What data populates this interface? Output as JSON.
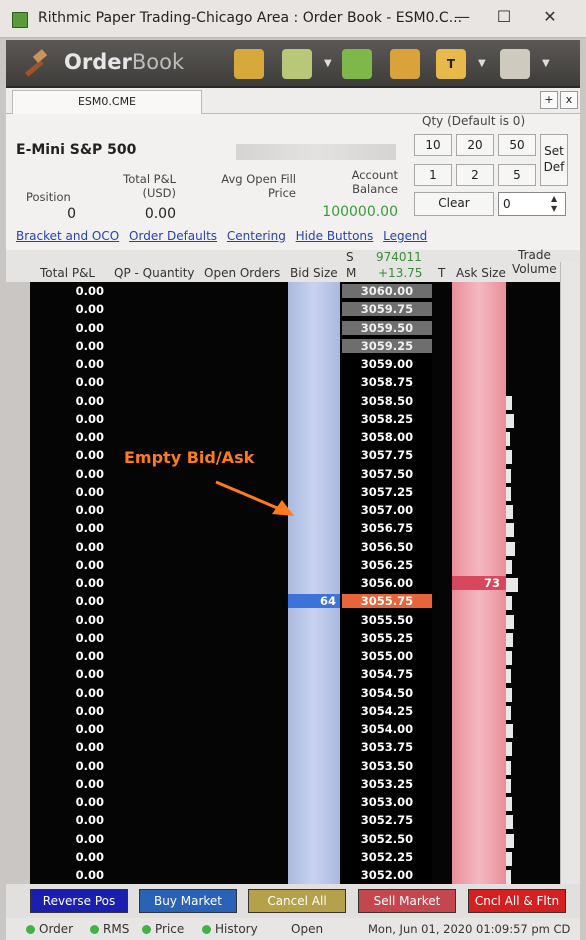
{
  "window": {
    "title": "Rithmic Paper Trading-Chicago Area : Order Book - ESM0.C..."
  },
  "toolbar": {
    "logo_bold": "Order",
    "logo_light": "Book"
  },
  "tab": {
    "label": "ESM0.CME",
    "add": "+",
    "close": "x"
  },
  "instrument": {
    "name": "E-Mini S&P 500"
  },
  "stats": {
    "position_label": "Position",
    "position": "0",
    "pnl_label": "Total P&L (USD)",
    "pnl": "0.00",
    "avg_label": "Avg Open Fill Price",
    "balance_label": "Account Balance",
    "balance": "100000.00"
  },
  "qty": {
    "title": "Qty (Default is 0)",
    "buttons": [
      "10",
      "20",
      "50",
      "1",
      "2",
      "5"
    ],
    "set_def": "Set Def",
    "clear": "Clear",
    "value": "0"
  },
  "links": [
    "Bracket and OCO",
    "Order Defaults",
    "Centering",
    "Hide Buttons",
    "Legend"
  ],
  "columns": {
    "total_pl": "Total P&L",
    "qp": "QP - Quantity",
    "open_orders": "Open Orders",
    "bid_size": "Bid Size",
    "s": "S",
    "m": "M",
    "volume": "974011",
    "change": "+13.75",
    "t": "T",
    "ask_size": "Ask Size",
    "trade": "Trade",
    "trade_volume": "Volume"
  },
  "ladder": [
    {
      "pl": "0.00",
      "price": "3060.00",
      "style": "gray"
    },
    {
      "pl": "0.00",
      "price": "3059.75",
      "style": "gray"
    },
    {
      "pl": "0.00",
      "price": "3059.50",
      "style": "gray"
    },
    {
      "pl": "0.00",
      "price": "3059.25",
      "style": "gray"
    },
    {
      "pl": "0.00",
      "price": "3059.00"
    },
    {
      "pl": "0.00",
      "price": "3058.75"
    },
    {
      "pl": "0.00",
      "price": "3058.50"
    },
    {
      "pl": "0.00",
      "price": "3058.25"
    },
    {
      "pl": "0.00",
      "price": "3058.00"
    },
    {
      "pl": "0.00",
      "price": "3057.75"
    },
    {
      "pl": "0.00",
      "price": "3057.50"
    },
    {
      "pl": "0.00",
      "price": "3057.25"
    },
    {
      "pl": "0.00",
      "price": "3057.00"
    },
    {
      "pl": "0.00",
      "price": "3056.75"
    },
    {
      "pl": "0.00",
      "price": "3056.50"
    },
    {
      "pl": "0.00",
      "price": "3056.25"
    },
    {
      "pl": "0.00",
      "price": "3056.00",
      "ask": "73"
    },
    {
      "pl": "0.00",
      "price": "3055.75",
      "style": "last",
      "bid": "64"
    },
    {
      "pl": "0.00",
      "price": "3055.50"
    },
    {
      "pl": "0.00",
      "price": "3055.25"
    },
    {
      "pl": "0.00",
      "price": "3055.00"
    },
    {
      "pl": "0.00",
      "price": "3054.75"
    },
    {
      "pl": "0.00",
      "price": "3054.50"
    },
    {
      "pl": "0.00",
      "price": "3054.25"
    },
    {
      "pl": "0.00",
      "price": "3054.00"
    },
    {
      "pl": "0.00",
      "price": "3053.75"
    },
    {
      "pl": "0.00",
      "price": "3053.50"
    },
    {
      "pl": "0.00",
      "price": "3053.25"
    },
    {
      "pl": "0.00",
      "price": "3053.00"
    },
    {
      "pl": "0.00",
      "price": "3052.75"
    },
    {
      "pl": "0.00",
      "price": "3052.50"
    },
    {
      "pl": "0.00",
      "price": "3052.25"
    },
    {
      "pl": "0.00",
      "price": "3052.00"
    }
  ],
  "annotation": "Empty Bid/Ask",
  "buttons": {
    "reverse": "Reverse Pos",
    "buy": "Buy Market",
    "cancel": "Cancel All",
    "sell": "Sell Market",
    "cncl_flat": "Cncl All & Fltn"
  },
  "colors": {
    "reverse": "#1a1fb0",
    "buy": "#2a62b8",
    "cancel": "#b4a14a",
    "sell": "#c4464f",
    "cncl_flat": "#d42020"
  },
  "status": {
    "order": "Order",
    "rms": "RMS",
    "price": "Price",
    "history": "History",
    "state": "Open",
    "datetime": "Mon, Jun 01, 2020 01:09:57 pm CD"
  }
}
